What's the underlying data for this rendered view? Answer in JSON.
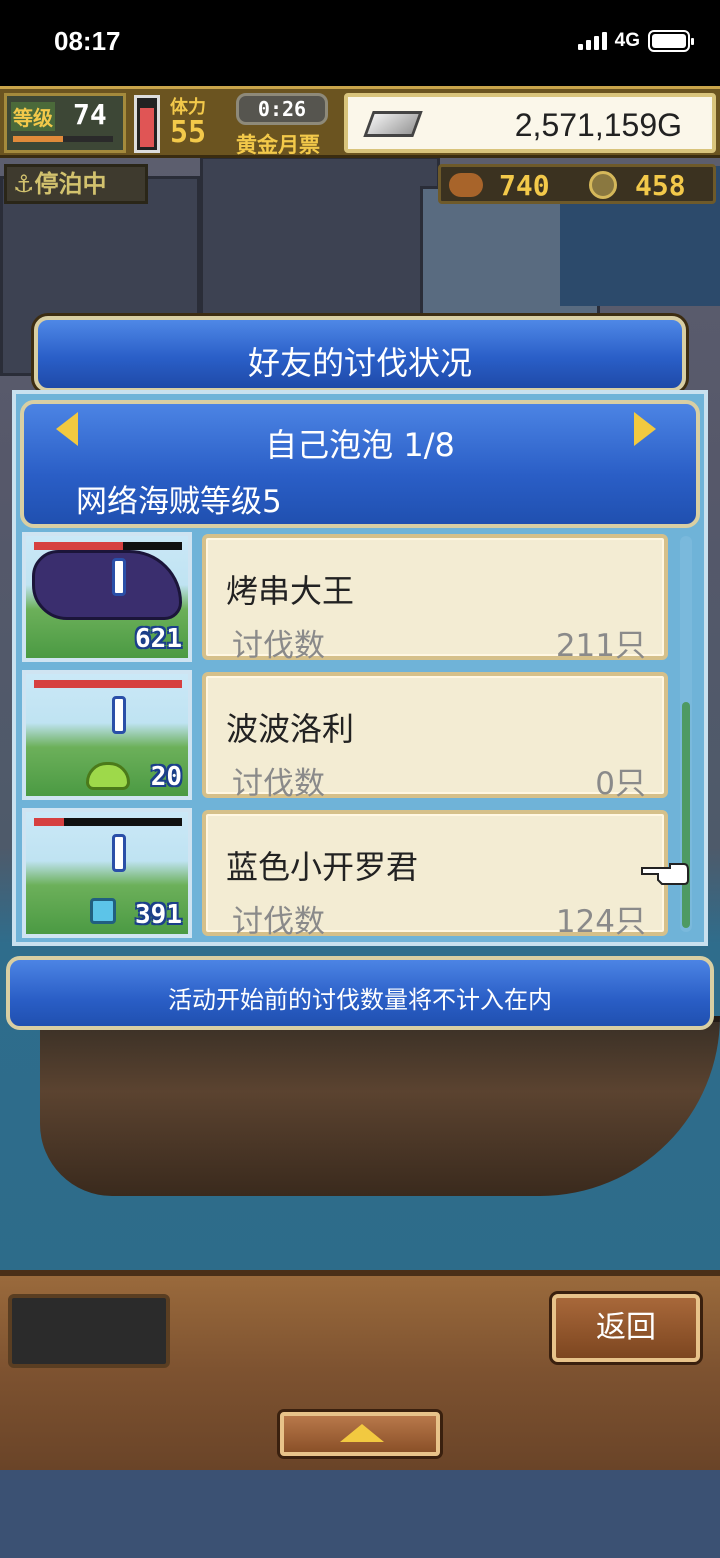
{
  "status_bar": {
    "time": "08:17",
    "network": "4G"
  },
  "hud": {
    "level_label": "等级",
    "level": "74",
    "level_progress": 0.5,
    "stamina_fill": 0.85,
    "stamina_label": "体力",
    "stamina": "55",
    "timer": "0:26",
    "gold_ticket_label": "黄金月票",
    "money": "2,571,159G",
    "dock_status": "停泊中",
    "resource_a": "740",
    "resource_b": "458"
  },
  "dialog": {
    "title": "好友的讨伐状况",
    "nav_title": "自己泡泡 1/8",
    "subtitle": "网络海贼等级5",
    "entries": [
      {
        "name": "烤串大王",
        "count_label": "讨伐数",
        "count": "211只",
        "level": "621",
        "hp": 0.6
      },
      {
        "name": "波波洛利",
        "count_label": "讨伐数",
        "count": "0只",
        "level": "20",
        "hp": 1.0
      },
      {
        "name": "蓝色小开罗君",
        "count_label": "讨伐数",
        "count": "124只",
        "level": "391",
        "hp": 0.2
      }
    ],
    "note": "活动开始前的讨伐数量将不计入在内"
  },
  "bottom": {
    "back_label": "返回"
  },
  "colors": {
    "banner_blue": "#2a5ec6",
    "card_bg": "#f3ecd3",
    "accent_gold": "#f2c940"
  }
}
